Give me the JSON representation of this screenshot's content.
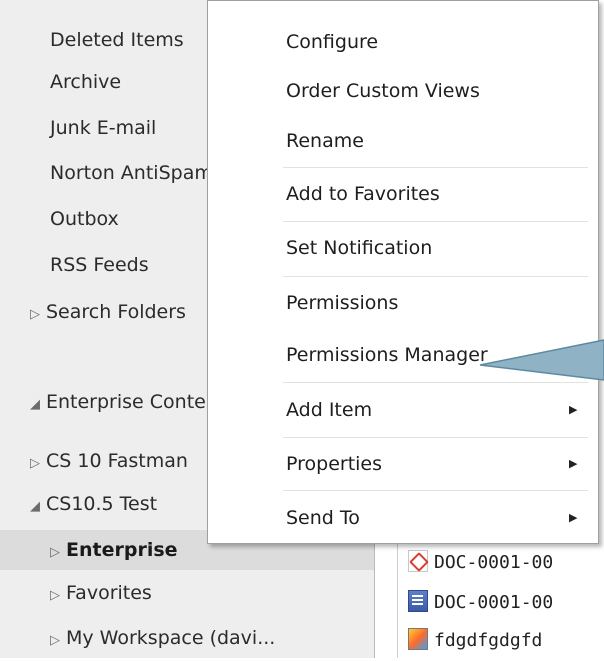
{
  "folders": [
    {
      "label": "Deleted Items",
      "expander": "",
      "bold": false
    },
    {
      "label": "Archive",
      "expander": "",
      "bold": false
    },
    {
      "label": "Junk E-mail",
      "expander": "",
      "bold": false
    },
    {
      "label": "Norton AntiSpam",
      "expander": "",
      "bold": false
    },
    {
      "label": "Outbox",
      "expander": "",
      "bold": false
    },
    {
      "label": "RSS Feeds",
      "expander": "",
      "bold": false
    },
    {
      "label": "Search Folders",
      "expander": "▷",
      "bold": false
    },
    {
      "label": "Enterprise Content",
      "expander": "◢",
      "bold": false
    },
    {
      "label": "CS 10 Fastman",
      "expander": "▷",
      "bold": false
    },
    {
      "label": "CS10.5 Test",
      "expander": "◢",
      "bold": false
    },
    {
      "label": "Enterprise",
      "expander": "▷",
      "bold": true
    },
    {
      "label": "Favorites",
      "expander": "▷",
      "bold": false
    },
    {
      "label": "My Workspace (davi...",
      "expander": "▷",
      "bold": false
    }
  ],
  "list_rows": [
    {
      "label": "DOC-0001-00",
      "icon": "pdf-icon"
    },
    {
      "label": "DOC-0001-00",
      "icon": "document-icon"
    },
    {
      "label": "fdgdfgdgfd",
      "icon": "image-icon"
    }
  ],
  "context_menu": {
    "items": [
      {
        "label": "Configure",
        "submenu": false
      },
      {
        "label": "Order Custom Views",
        "submenu": false
      },
      {
        "label": "Rename",
        "submenu": false
      },
      {
        "label": "Add to Favorites",
        "submenu": false
      },
      {
        "label": "Set Notification",
        "submenu": false
      },
      {
        "label": "Permissions",
        "submenu": false
      },
      {
        "label": "Permissions Manager",
        "submenu": false
      },
      {
        "label": "Add Item",
        "submenu": true
      },
      {
        "label": "Properties",
        "submenu": true
      },
      {
        "label": "Send To",
        "submenu": true
      }
    ],
    "submenu_arrow": "▶"
  },
  "colors": {
    "folder_pane": "#eeeeee",
    "selection": "#dcdcdc",
    "callout": "#8fb2c4"
  }
}
